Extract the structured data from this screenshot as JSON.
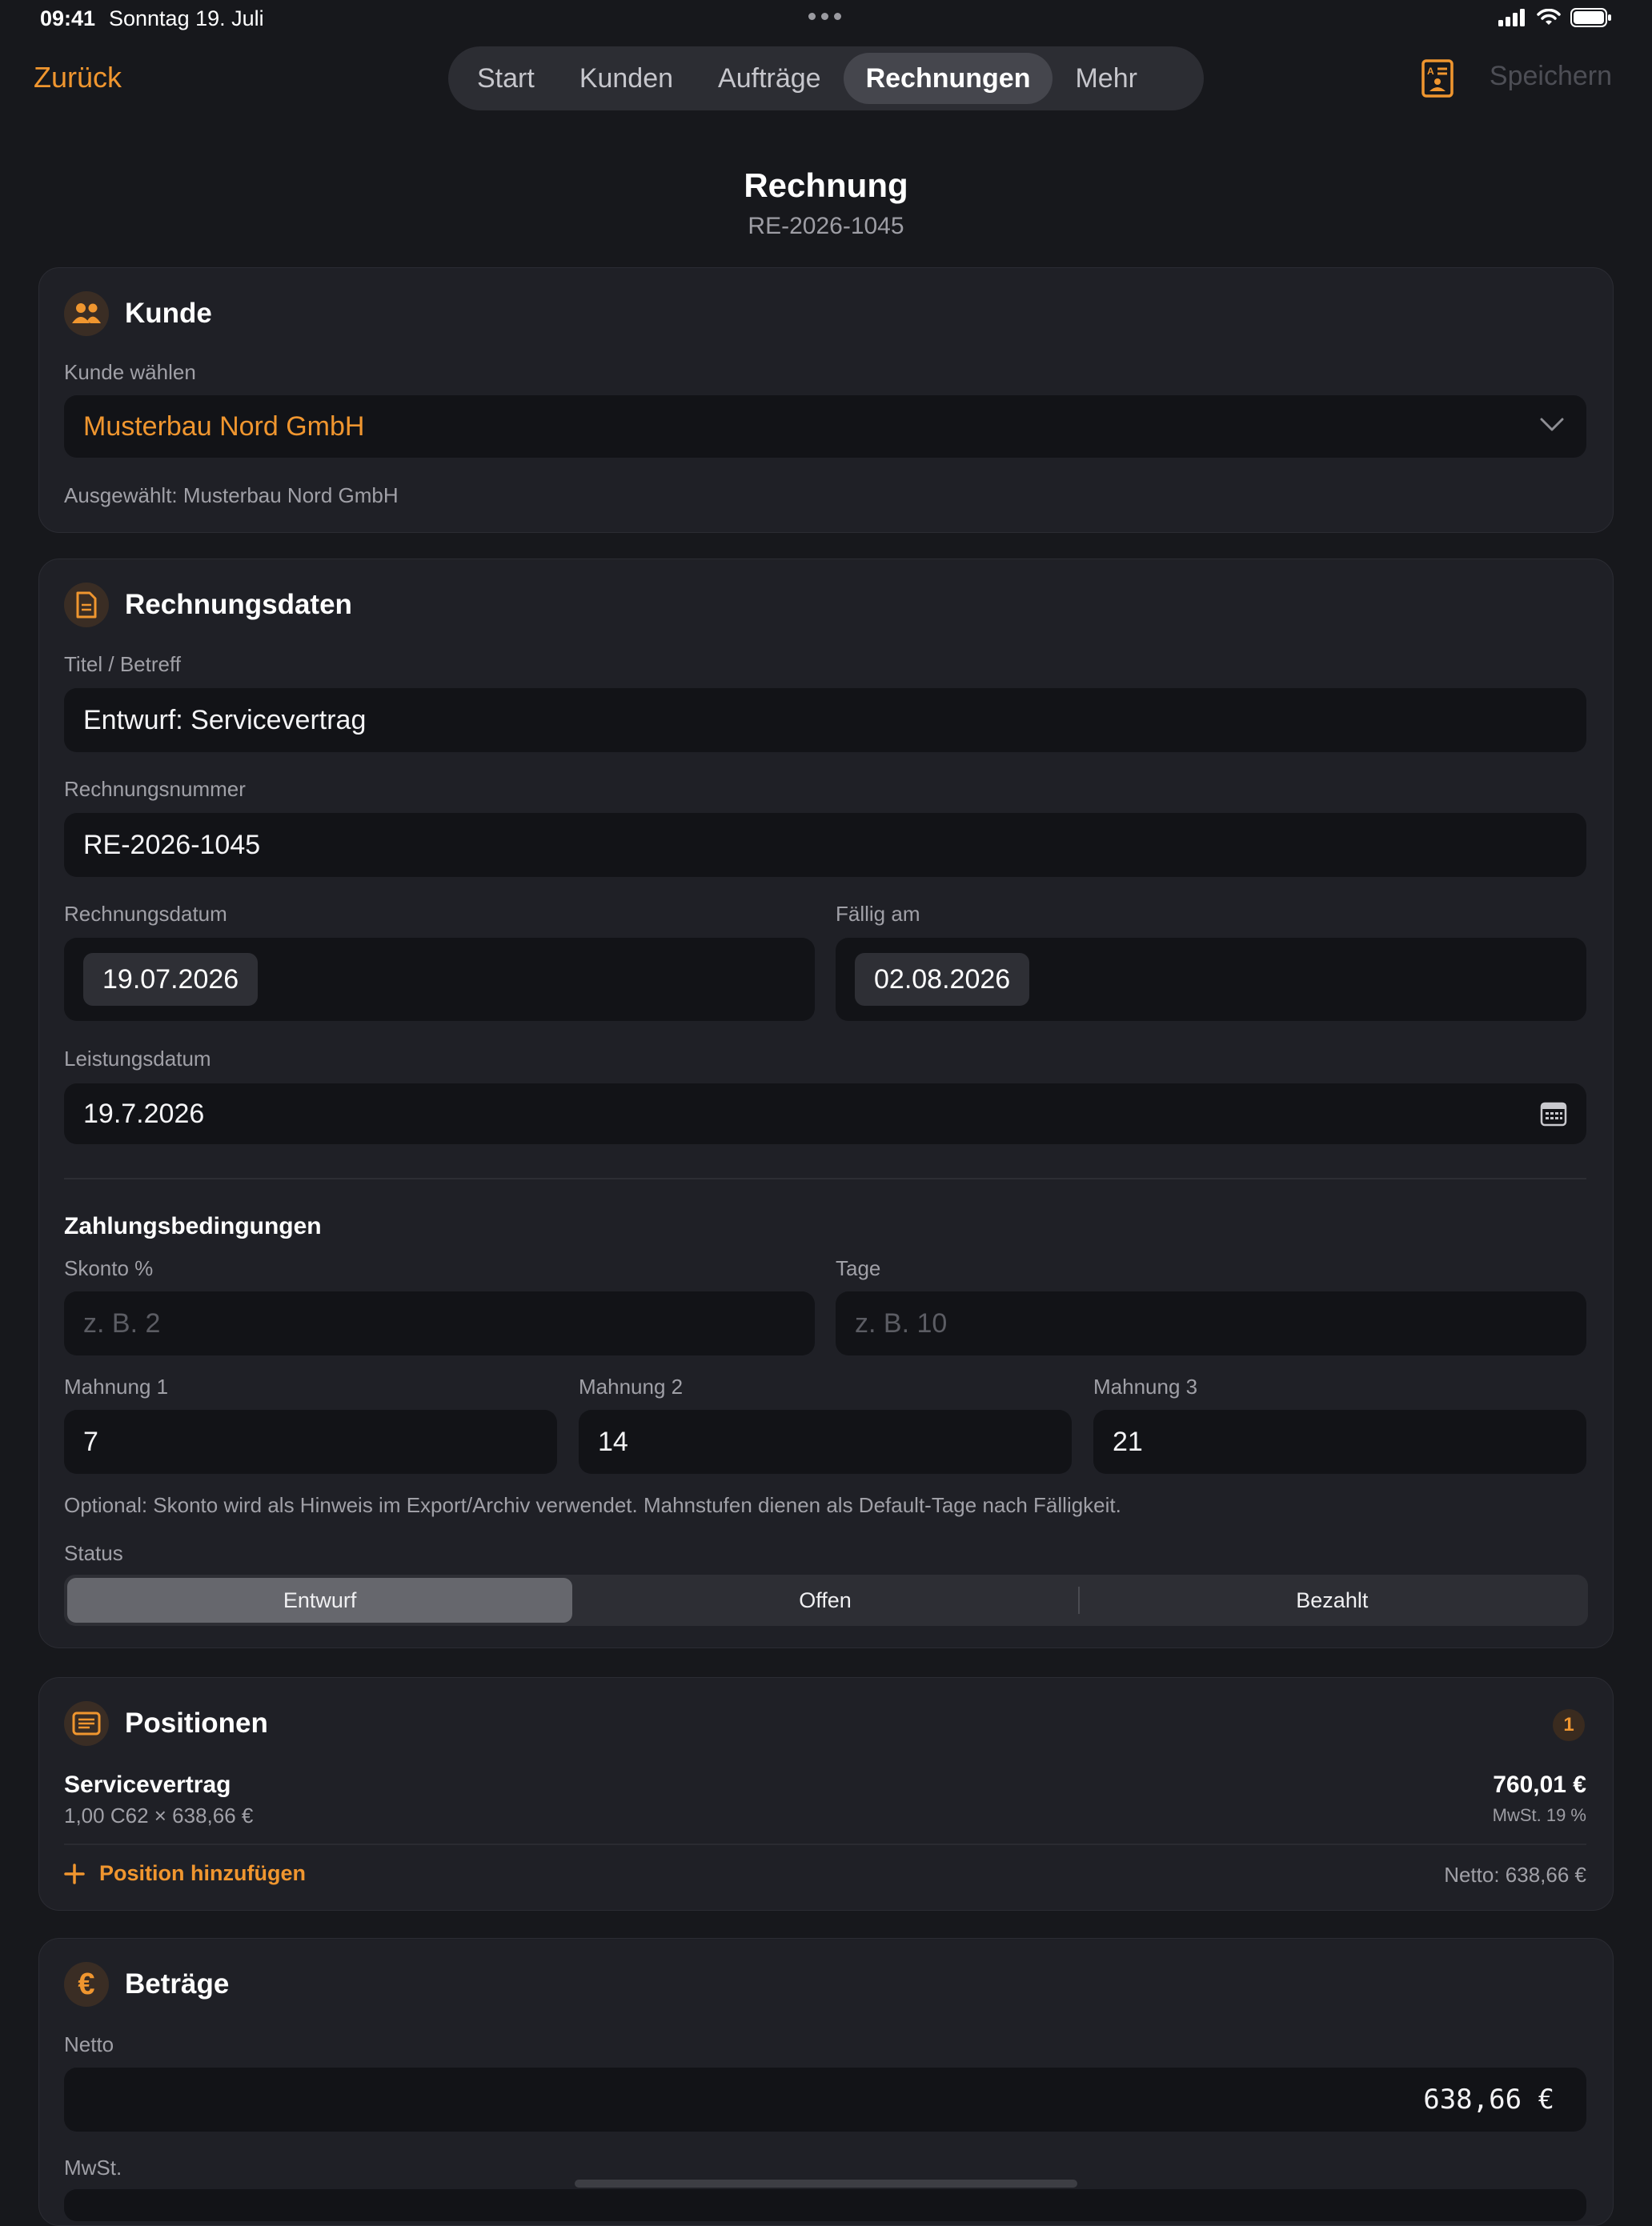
{
  "status_bar": {
    "time": "09:41",
    "date": "Sonntag 19. Juli"
  },
  "nav": {
    "back_label": "Zurück",
    "tabs": [
      "Start",
      "Kunden",
      "Aufträge",
      "Rechnungen",
      "Mehr"
    ],
    "active_tab": "Rechnungen",
    "save_label": "Speichern"
  },
  "header": {
    "title": "Rechnung",
    "subtitle": "RE-2026-1045"
  },
  "customer": {
    "title": "Kunde",
    "select_label": "Kunde wählen",
    "selected_value": "Musterbau Nord GmbH",
    "selected_hint": "Ausgewählt: Musterbau Nord GmbH"
  },
  "invoice_data": {
    "title": "Rechnungsdaten",
    "title_label": "Titel / Betreff",
    "title_value": "Entwurf: Servicevertrag",
    "number_label": "Rechnungsnummer",
    "number_value": "RE-2026-1045",
    "date_label": "Rechnungsdatum",
    "date_value": "19.07.2026",
    "due_label": "Fällig am",
    "due_value": "02.08.2026",
    "service_date_label": "Leistungsdatum",
    "service_date_value": "19.7.2026",
    "payment_terms": {
      "title": "Zahlungsbedingungen",
      "skonto_label": "Skonto %",
      "skonto_placeholder": "z. B. 2",
      "days_label": "Tage",
      "days_placeholder": "z. B. 10",
      "dunning1_label": "Mahnung 1",
      "dunning1_value": "7",
      "dunning2_label": "Mahnung 2",
      "dunning2_value": "14",
      "dunning3_label": "Mahnung 3",
      "dunning3_value": "21",
      "hint": "Optional: Skonto wird als Hinweis im Export/Archiv verwendet. Mahnstufen dienen als Default-Tage nach Fälligkeit."
    },
    "status_label": "Status",
    "status_options": [
      "Entwurf",
      "Offen",
      "Bezahlt"
    ],
    "status_selected": "Entwurf"
  },
  "positions": {
    "title": "Positionen",
    "count": "1",
    "items": [
      {
        "name": "Servicevertrag",
        "detail": "1,00 C62 × 638,66 €",
        "total": "760,01 €",
        "tax": "MwSt. 19 %"
      }
    ],
    "add_label": "Position hinzufügen",
    "net_summary": "Netto: 638,66 €"
  },
  "amounts": {
    "title": "Beträge",
    "net_label": "Netto",
    "net_value": "638,66 €",
    "vat_label": "MwSt."
  },
  "colors": {
    "accent": "#f0962f",
    "background": "#17181c",
    "card": "#1f2026",
    "field": "#121317"
  }
}
